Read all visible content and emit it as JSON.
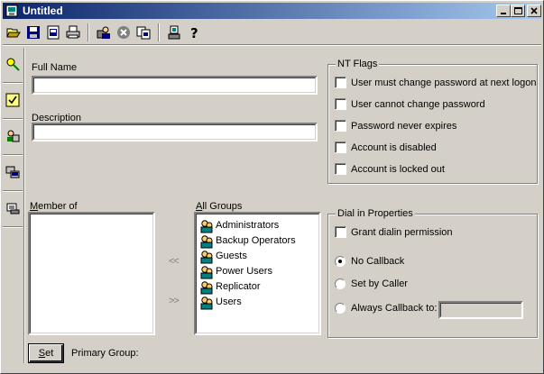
{
  "window": {
    "title": "Untitled"
  },
  "toolbar": {
    "items": [
      "open-folder-icon",
      "save-icon",
      "save-all-icon",
      "print-icon",
      "user-manager-icon",
      "delete-icon",
      "copy-icon",
      "properties-icon",
      "help-icon"
    ]
  },
  "sidetabs": [
    "user-key-icon",
    "checklist-icon",
    "group-icon",
    "computers-icon",
    "profile-icon"
  ],
  "form": {
    "full_name_label": "Full Name",
    "full_name_value": "",
    "description_label": "Description",
    "description_value": ""
  },
  "nt_flags": {
    "legend": "NT Flags",
    "options": [
      {
        "label": "User must change password at next logon",
        "checked": false
      },
      {
        "label": "User cannot change password",
        "checked": false
      },
      {
        "label": "Password never expires",
        "checked": false
      },
      {
        "label": "Account is disabled",
        "checked": false
      },
      {
        "label": "Account is locked out",
        "checked": false
      }
    ]
  },
  "member_of": {
    "label_prefix": "M",
    "label_rest": "ember of",
    "items": []
  },
  "all_groups": {
    "label_prefix": "A",
    "label_rest": "ll Groups",
    "items": [
      "Administrators",
      "Backup Operators",
      "Guests",
      "Power Users",
      "Replicator",
      "Users"
    ]
  },
  "transfer": {
    "add": "<<",
    "remove": ">>"
  },
  "dialin": {
    "legend": "Dial in Properties",
    "grant_label": "Grant dialin permission",
    "grant_checked": false,
    "no_callback": "No Callback",
    "set_by_caller": "Set by Caller",
    "always_callback": "Always Callback to:",
    "selected": "no_callback",
    "callback_number": ""
  },
  "footer": {
    "set_prefix": "S",
    "set_rest": "et",
    "primary_group_label": "Primary Group:"
  }
}
